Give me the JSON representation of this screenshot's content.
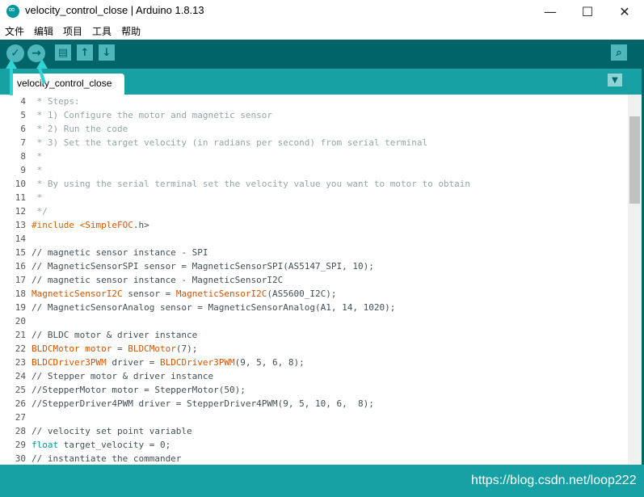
{
  "window": {
    "title": "velocity_control_close | Arduino 1.8.13",
    "minimize": "—",
    "maximize": "☐",
    "close": "✕"
  },
  "menu": [
    "文件",
    "编辑",
    "项目",
    "工具",
    "帮助"
  ],
  "toolbar": {
    "verify": "✓",
    "upload": "→",
    "new": "▤",
    "open": "↑",
    "save": "↓",
    "serial_monitor": "⌕"
  },
  "tab": {
    "label": "velocity_control_close",
    "menu_icon": "▼"
  },
  "code_lines": [
    {
      "n": "4",
      "parts": [
        {
          "t": " * Steps:",
          "c": "c-comment"
        }
      ]
    },
    {
      "n": "5",
      "parts": [
        {
          "t": " * 1) Configure the motor and magnetic sensor",
          "c": "c-comment"
        }
      ]
    },
    {
      "n": "6",
      "parts": [
        {
          "t": " * 2) Run the code",
          "c": "c-comment"
        }
      ]
    },
    {
      "n": "7",
      "parts": [
        {
          "t": " * 3) Set the target velocity (in radians per second) from serial terminal",
          "c": "c-comment"
        }
      ]
    },
    {
      "n": "8",
      "parts": [
        {
          "t": " *",
          "c": "c-comment"
        }
      ]
    },
    {
      "n": "9",
      "parts": [
        {
          "t": " *",
          "c": "c-comment"
        }
      ]
    },
    {
      "n": "10",
      "parts": [
        {
          "t": " * By using the serial terminal set the velocity value you want to motor to obtain",
          "c": "c-comment"
        }
      ]
    },
    {
      "n": "11",
      "parts": [
        {
          "t": " *",
          "c": "c-comment"
        }
      ]
    },
    {
      "n": "12",
      "parts": [
        {
          "t": " */",
          "c": "c-comment"
        }
      ]
    },
    {
      "n": "13",
      "parts": [
        {
          "t": "#include <",
          "c": "c-kw"
        },
        {
          "t": "SimpleFOC",
          "c": "c-str"
        },
        {
          "t": ".h>",
          "c": ""
        }
      ]
    },
    {
      "n": "14",
      "parts": []
    },
    {
      "n": "15",
      "parts": [
        {
          "t": "// magnetic sensor instance - SPI",
          "c": ""
        }
      ]
    },
    {
      "n": "16",
      "parts": [
        {
          "t": "// MagneticSensorSPI sensor = MagneticSensorSPI(AS5147_SPI, 10);",
          "c": ""
        }
      ]
    },
    {
      "n": "17",
      "parts": [
        {
          "t": "// magnetic sensor instance - MagneticSensorI2C",
          "c": ""
        }
      ]
    },
    {
      "n": "18",
      "parts": [
        {
          "t": "MagneticSensorI2C",
          "c": "c-str"
        },
        {
          "t": " sensor = ",
          "c": ""
        },
        {
          "t": "MagneticSensorI2C",
          "c": "c-str"
        },
        {
          "t": "(AS5600_I2C);",
          "c": ""
        }
      ]
    },
    {
      "n": "19",
      "parts": [
        {
          "t": "// MagneticSensorAnalog sensor = MagneticSensorAnalog(A1, 14, 1020);",
          "c": ""
        }
      ]
    },
    {
      "n": "20",
      "parts": []
    },
    {
      "n": "21",
      "parts": [
        {
          "t": "// BLDC motor & driver instance",
          "c": ""
        }
      ]
    },
    {
      "n": "22",
      "parts": [
        {
          "t": "BLDCMotor",
          "c": "c-str"
        },
        {
          "t": " ",
          "c": ""
        },
        {
          "t": "motor",
          "c": "c-str"
        },
        {
          "t": " = ",
          "c": ""
        },
        {
          "t": "BLDCMotor",
          "c": "c-str"
        },
        {
          "t": "(7);",
          "c": ""
        }
      ]
    },
    {
      "n": "23",
      "parts": [
        {
          "t": "BLDCDriver3PWM",
          "c": "c-str"
        },
        {
          "t": " driver = ",
          "c": ""
        },
        {
          "t": "BLDCDriver3PWM",
          "c": "c-str"
        },
        {
          "t": "(9, 5, 6, 8);",
          "c": ""
        }
      ]
    },
    {
      "n": "24",
      "parts": [
        {
          "t": "// Stepper motor & driver instance",
          "c": ""
        }
      ]
    },
    {
      "n": "25",
      "parts": [
        {
          "t": "//StepperMotor motor = StepperMotor(50);",
          "c": ""
        }
      ]
    },
    {
      "n": "26",
      "parts": [
        {
          "t": "//StepperDriver4PWM driver = StepperDriver4PWM(9, 5, 10, 6,  8);",
          "c": ""
        }
      ]
    },
    {
      "n": "27",
      "parts": []
    },
    {
      "n": "28",
      "parts": [
        {
          "t": "// velocity set point variable",
          "c": ""
        }
      ]
    },
    {
      "n": "29",
      "parts": [
        {
          "t": "float",
          "c": "c-type"
        },
        {
          "t": " target_velocity = 0;",
          "c": ""
        }
      ]
    },
    {
      "n": "30",
      "parts": [
        {
          "t": "// instantiate the commander",
          "c": ""
        }
      ]
    }
  ],
  "watermark": "https://blog.csdn.net/loop222"
}
